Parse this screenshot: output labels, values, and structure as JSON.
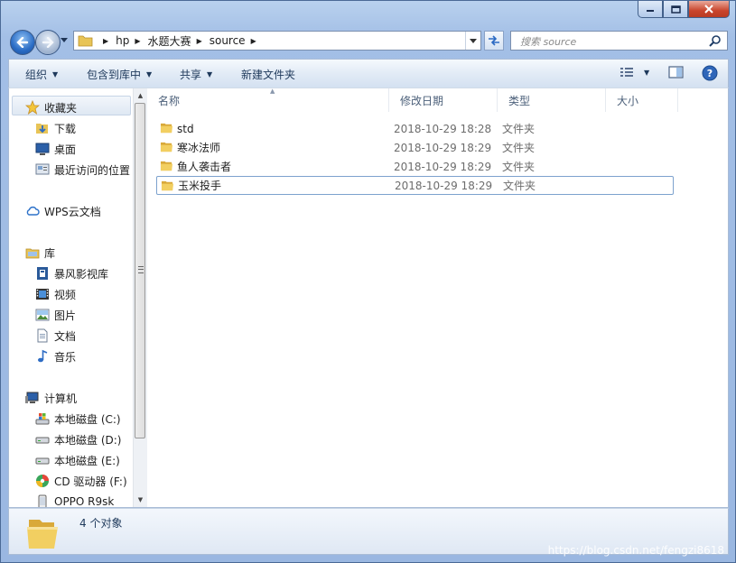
{
  "address": {
    "crumbs": [
      "hp",
      "水题大赛",
      "source"
    ]
  },
  "search": {
    "placeholder": "搜索 source"
  },
  "toolbar": {
    "organize": "组织",
    "include_in_library": "包含到库中",
    "share": "共享",
    "new_folder": "新建文件夹"
  },
  "nav": {
    "favorites": "收藏夹",
    "downloads": "下载",
    "desktop": "桌面",
    "recent": "最近访问的位置",
    "wps": "WPS云文档",
    "libraries": "库",
    "baofeng": "暴风影视库",
    "videos": "视频",
    "pictures": "图片",
    "documents": "文档",
    "music": "音乐",
    "computer": "计算机",
    "drive_c": "本地磁盘 (C:)",
    "drive_d": "本地磁盘 (D:)",
    "drive_e": "本地磁盘 (E:)",
    "drive_f": "CD 驱动器 (F:)",
    "oppo": "OPPO R9sk"
  },
  "columns": {
    "name": "名称",
    "date": "修改日期",
    "type": "类型",
    "size": "大小"
  },
  "files": [
    {
      "name": "std",
      "date": "2018-10-29 18:28",
      "type": "文件夹"
    },
    {
      "name": "寒冰法师",
      "date": "2018-10-29 18:29",
      "type": "文件夹"
    },
    {
      "name": "鱼人袭击者",
      "date": "2018-10-29 18:29",
      "type": "文件夹"
    },
    {
      "name": "玉米投手",
      "date": "2018-10-29 18:29",
      "type": "文件夹"
    }
  ],
  "status": {
    "count": "4 个对象"
  },
  "watermark": "https://blog.csdn.net/fengzi8618",
  "colors": {
    "folder": "#e8c456",
    "accent": "#1e395b",
    "selection_border": "#7da2ce"
  }
}
